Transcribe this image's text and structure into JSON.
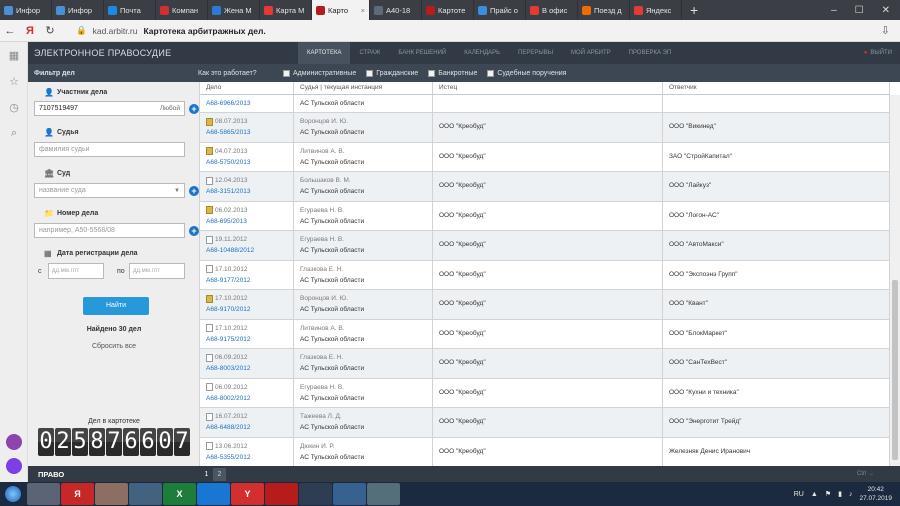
{
  "browser": {
    "tabs": [
      {
        "label": "Инфор",
        "color": "#4a90d9"
      },
      {
        "label": "Инфор",
        "color": "#4a90d9"
      },
      {
        "label": "Почта",
        "color": "#1e88e5"
      },
      {
        "label": "Компан",
        "color": "#d32f2f"
      },
      {
        "label": "Жена М",
        "color": "#2b7bd6"
      },
      {
        "label": "Карта М",
        "color": "#e53935"
      },
      {
        "label": "Карто",
        "color": "#b71c1c",
        "active": true
      },
      {
        "label": "А40-18",
        "color": "#5e6b7a"
      },
      {
        "label": "Картоте",
        "color": "#b71c1c"
      },
      {
        "label": "Прайс о",
        "color": "#3c8dde"
      },
      {
        "label": "В офис",
        "color": "#e53935"
      },
      {
        "label": "Поезд д",
        "color": "#ef6c00"
      },
      {
        "label": "Яндекс",
        "color": "#e53935"
      }
    ],
    "url_domain": "kad.arbitr.ru",
    "page_title": "Картотека арбитражных дел."
  },
  "topnav": {
    "brand": "ЭЛЕКТРОННОЕ ПРАВОСУДИЕ",
    "items": [
      "КАРТОТЕКА",
      "СТРАЖ",
      "БАНК РЕШЕНИЙ",
      "КАЛЕНДАРЬ",
      "ПЕРЕРЫВЫ",
      "МОЙ АРБИТР",
      "ПРОВЕРКА ЭП"
    ],
    "logout": "ВЫЙТИ"
  },
  "filterbar": {
    "title": "Фильтр дел",
    "how": "Как это работает?",
    "categories": [
      "Административные",
      "Гражданские",
      "Банкротные",
      "Судебные поручения"
    ]
  },
  "filter": {
    "participant_label": "Участник дела",
    "participant_value": "7107519497",
    "participant_mode": "Любой",
    "judge_label": "Судья",
    "judge_placeholder": "фамилия судьи",
    "court_label": "Суд",
    "court_placeholder": "название суда",
    "case_label": "Номер дела",
    "case_placeholder": "например, А50-5568/08",
    "date_label": "Дата регистрации дела",
    "from_label": "с",
    "to_label": "по",
    "date_placeholder": "дд.мм.гггг",
    "find_button": "Найти",
    "found_text": "Найдено 30 дел",
    "reset_text": "Сбросить все",
    "counter_label": "Дел в картотеке",
    "counter_digits": [
      "0",
      "2",
      "5",
      "8",
      "7",
      "6",
      "6",
      "0",
      "7"
    ]
  },
  "table": {
    "headers": [
      "Дело",
      "Судья | текущая инстанция",
      "Истец",
      "Ответчик"
    ],
    "rows": [
      {
        "date": "",
        "case": "А68-6966/2013",
        "judge": "",
        "court": "АС Тульской области",
        "plaintiff": "",
        "defendant": "",
        "icon": "none"
      },
      {
        "date": "08.07.2013",
        "case": "А68-5865/2013",
        "judge": "Воронцов И. Ю.",
        "court": "АС Тульской области",
        "plaintiff": "ООО \"Креобуд\"",
        "defendant": "ООО \"Викинед\"",
        "icon": "y"
      },
      {
        "date": "04.07.2013",
        "case": "А68-5750/2013",
        "judge": "Литвинов А. В.",
        "court": "АС Тульской области",
        "plaintiff": "ООО \"Креобуд\"",
        "defendant": "ЗАО \"СтройКапитал\"",
        "icon": "y"
      },
      {
        "date": "12.04.2013",
        "case": "А68-3151/2013",
        "judge": "Большаков В. М.",
        "court": "АС Тульской области",
        "plaintiff": "ООО \"Креобуд\"",
        "defendant": "ООО \"Лайкуз\"",
        "icon": "w"
      },
      {
        "date": "06.02.2013",
        "case": "А68-695/2013",
        "judge": "Егураева Н. В.",
        "court": "АС Тульской области",
        "plaintiff": "ООО \"Креобуд\"",
        "defendant": "ООО \"Логон-АС\"",
        "icon": "y"
      },
      {
        "date": "19.11.2012",
        "case": "А68-10488/2012",
        "judge": "Егураева Н. В.",
        "court": "АС Тульской области",
        "plaintiff": "ООО \"Креобуд\"",
        "defendant": "ООО \"АвтоМакси\"",
        "icon": "w"
      },
      {
        "date": "17.10.2012",
        "case": "А68-9177/2012",
        "judge": "Глазкова Е. Н.",
        "court": "АС Тульской области",
        "plaintiff": "ООО \"Креобуд\"",
        "defendant": "ООО \"Экспоэнэ Групп\"",
        "icon": "w"
      },
      {
        "date": "17.10.2012",
        "case": "А68-9170/2012",
        "judge": "Воронцов И. Ю.",
        "court": "АС Тульской области",
        "plaintiff": "ООО \"Креобуд\"",
        "defendant": "ООО \"Квант\"",
        "icon": "y"
      },
      {
        "date": "17.10.2012",
        "case": "А68-9175/2012",
        "judge": "Литвинов А. В.",
        "court": "АС Тульской области",
        "plaintiff": "ООО \"Креобуд\"",
        "defendant": "ООО \"БлокМаркет\"",
        "icon": "w"
      },
      {
        "date": "06.09.2012",
        "case": "А68-8003/2012",
        "judge": "Глазкова Е. Н.",
        "court": "АС Тульской области",
        "plaintiff": "ООО \"Креобуд\"",
        "defendant": "ООО \"СанТехВест\"",
        "icon": "w"
      },
      {
        "date": "06.09.2012",
        "case": "А68-8002/2012",
        "judge": "Егураева Н. В.",
        "court": "АС Тульской области",
        "plaintiff": "ООО \"Креобуд\"",
        "defendant": "ООО \"Кухни и техника\"",
        "icon": "w"
      },
      {
        "date": "16.07.2012",
        "case": "А68-6488/2012",
        "judge": "Тажеева Л. Д.",
        "court": "АС Тульской области",
        "plaintiff": "ООО \"Креобуд\"",
        "defendant": "ООО \"Энерготит Трейд\"",
        "icon": "w"
      },
      {
        "date": "13.06.2012",
        "case": "А68-5355/2012",
        "judge": "Дюкин И. Р.",
        "court": "АС Тульской области",
        "plaintiff": "ООО \"Креобуд\"",
        "defendant": "Железняк Денис Иранович",
        "icon": "w"
      }
    ]
  },
  "footer": {
    "logo": "ПРАВО",
    "current_page": "1",
    "next_page": "2",
    "next_label": "Ctrl →"
  },
  "taskbar": {
    "apps": [
      {
        "label": "",
        "color": "#5a6475"
      },
      {
        "label": "Я",
        "color": "#c62828"
      },
      {
        "label": "",
        "color": "#8d6e63"
      },
      {
        "label": "",
        "color": "#42627f"
      },
      {
        "label": "X",
        "color": "#1e7d3a"
      },
      {
        "label": "",
        "color": "#1976d2"
      },
      {
        "label": "Y",
        "color": "#d32f2f"
      },
      {
        "label": "",
        "color": "#b71c1c"
      },
      {
        "label": "",
        "color": "#2e3d52"
      },
      {
        "label": "",
        "color": "#37618f"
      },
      {
        "label": "",
        "color": "#546e7a"
      }
    ],
    "lang": "RU",
    "time": "20:42",
    "date": "27.07.2019"
  }
}
